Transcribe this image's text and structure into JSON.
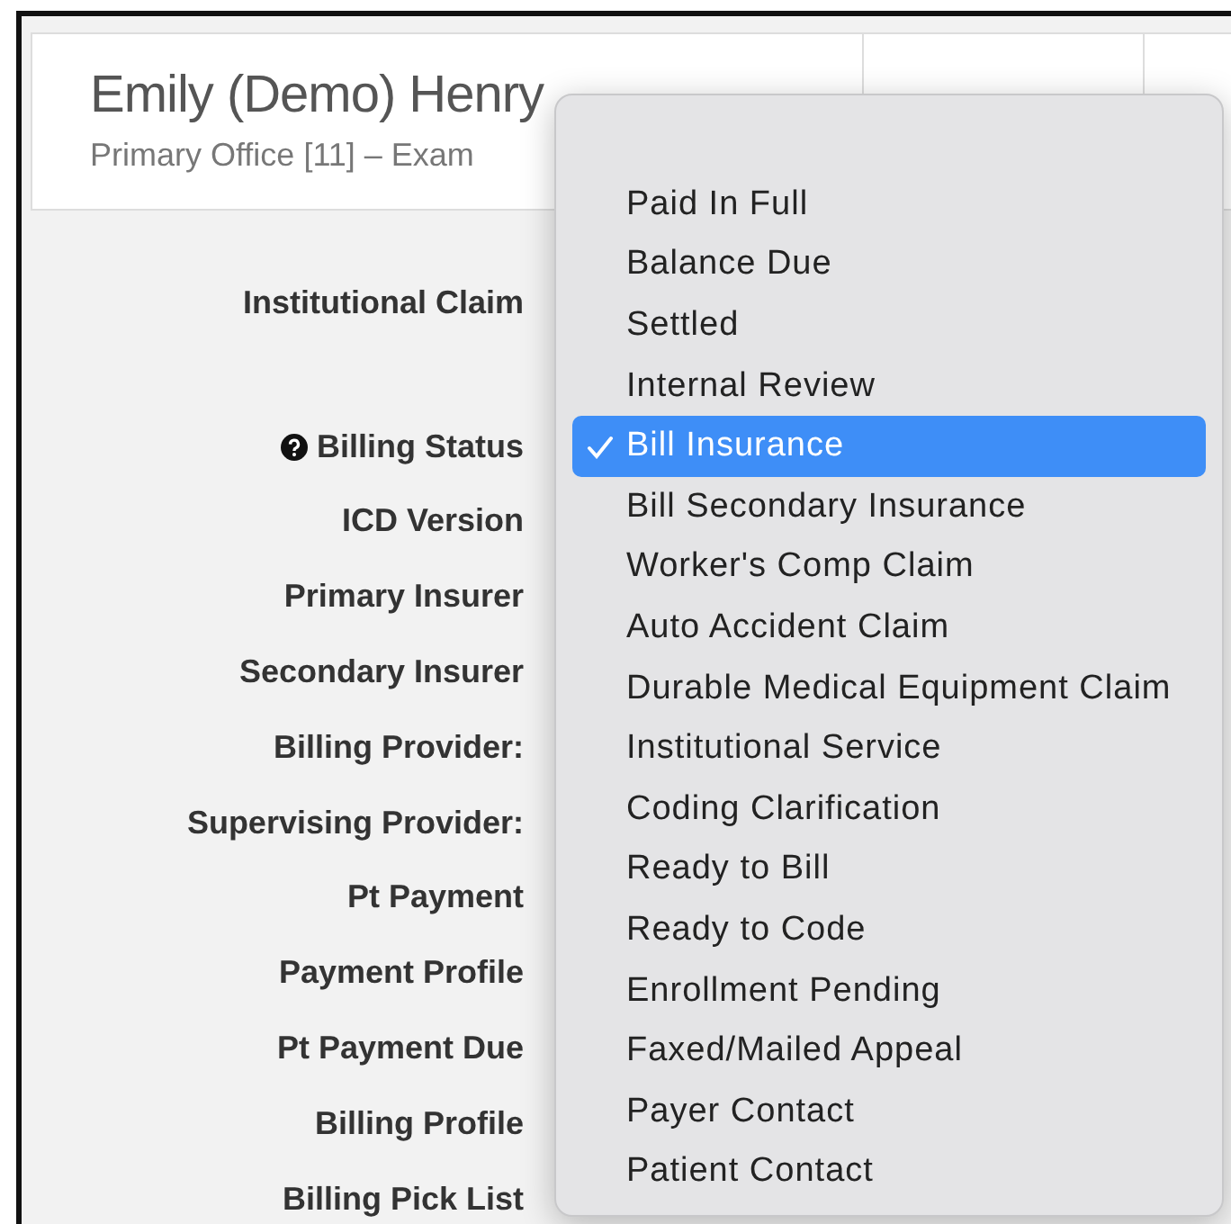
{
  "header": {
    "patient_name": "Emily (Demo) Henry",
    "subtitle": "Primary Office [11] – Exam"
  },
  "form_labels": [
    {
      "text": "Institutional Claim",
      "kind": "plain"
    },
    {
      "text": "Billing Status",
      "kind": "help"
    },
    {
      "text": "ICD Version",
      "kind": "plain"
    },
    {
      "text": "Primary Insurer",
      "kind": "plain"
    },
    {
      "text": "Secondary Insurer",
      "kind": "plain"
    },
    {
      "text": "Billing Provider:",
      "kind": "plain"
    },
    {
      "text": "Supervising Provider:",
      "kind": "plain"
    },
    {
      "text": "Pt Payment",
      "kind": "plain"
    },
    {
      "text": "Payment Profile",
      "kind": "plain"
    },
    {
      "text": "Pt Payment Due",
      "kind": "plain"
    },
    {
      "text": "Billing Profile",
      "kind": "plain"
    },
    {
      "text": "Billing Pick List",
      "kind": "plain"
    }
  ],
  "status_menu": [
    {
      "label": "Paid In Full",
      "selected": false
    },
    {
      "label": "Balance Due",
      "selected": false
    },
    {
      "label": "Settled",
      "selected": false
    },
    {
      "label": "Internal Review",
      "selected": false
    },
    {
      "label": "Bill Insurance",
      "selected": true
    },
    {
      "label": "Bill Secondary Insurance",
      "selected": false
    },
    {
      "label": "Worker's Comp Claim",
      "selected": false
    },
    {
      "label": "Auto Accident Claim",
      "selected": false
    },
    {
      "label": "Durable Medical Equipment Claim",
      "selected": false
    },
    {
      "label": "Institutional Service",
      "selected": false
    },
    {
      "label": "Coding Clarification",
      "selected": false
    },
    {
      "label": "Ready to Bill",
      "selected": false
    },
    {
      "label": "Ready to Code",
      "selected": false
    },
    {
      "label": "Enrollment Pending",
      "selected": false
    },
    {
      "label": "Faxed/Mailed Appeal",
      "selected": false
    },
    {
      "label": "Payer Contact",
      "selected": false
    },
    {
      "label": "Patient Contact",
      "selected": false
    }
  ]
}
